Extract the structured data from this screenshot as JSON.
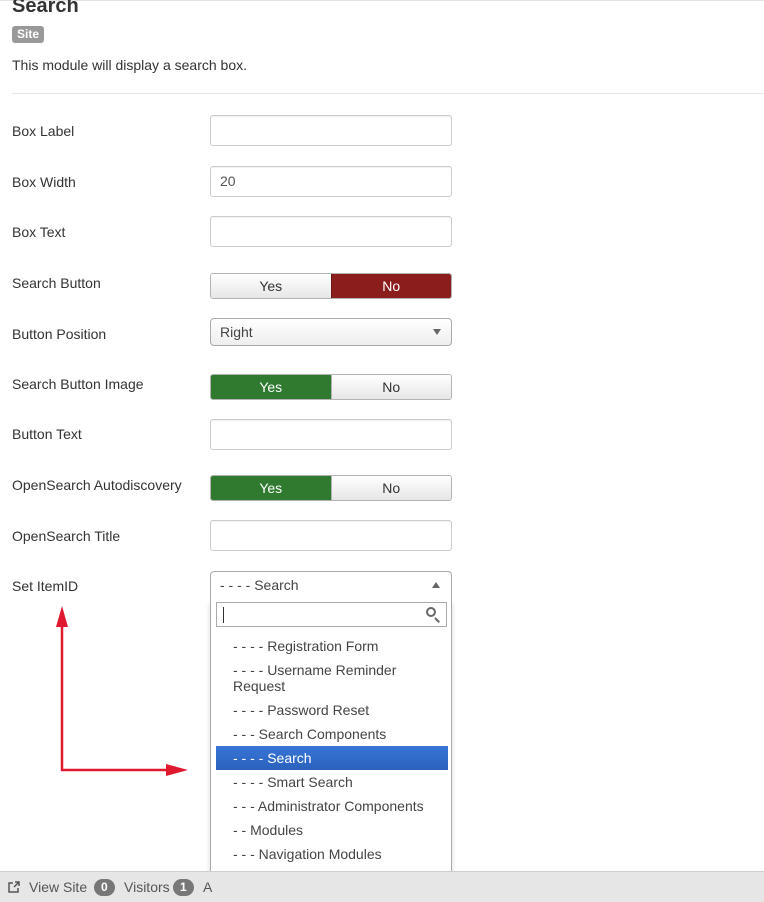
{
  "module": {
    "title": "Search",
    "client_badge": "Site",
    "description": "This module will display a search box."
  },
  "fields": {
    "box_label": {
      "label": "Box Label",
      "value": ""
    },
    "box_width": {
      "label": "Box Width",
      "value": "20"
    },
    "box_text": {
      "label": "Box Text",
      "value": ""
    },
    "search_button": {
      "label": "Search Button",
      "yes": "Yes",
      "no": "No",
      "selected": "No"
    },
    "button_position": {
      "label": "Button Position",
      "value": "Right"
    },
    "search_button_image": {
      "label": "Search Button Image",
      "yes": "Yes",
      "no": "No",
      "selected": "Yes"
    },
    "button_text": {
      "label": "Button Text",
      "value": ""
    },
    "opensearch_autodiscovery": {
      "label": "OpenSearch Autodiscovery",
      "yes": "Yes",
      "no": "No",
      "selected": "Yes"
    },
    "opensearch_title": {
      "label": "OpenSearch Title",
      "value": ""
    },
    "set_itemid": {
      "label": "Set ItemID",
      "value": "- - - - Search",
      "search_value": "",
      "options": [
        "- - - - Registration Form",
        "- - - - Username Reminder Request",
        "- - - - Password Reset",
        "- - - Search Components",
        "- - - - Search",
        "- - - - Smart Search",
        "- - - Administrator Components",
        "- - Modules",
        "- - - Navigation Modules"
      ],
      "highlighted_index": 4
    }
  },
  "footer": {
    "view_site": "View Site",
    "visitors_count": "0",
    "visitors_label": "Visitors",
    "admins_count": "1",
    "admins_label": "A"
  },
  "colors": {
    "toggle_no_active": "#8c1d1d",
    "toggle_yes_active": "#2f7a2f",
    "option_highlight": "#3875d7",
    "annotation_arrow": "#e0192f"
  },
  "icons": {
    "dropdown_search": "search-icon",
    "view_site": "external-link-icon"
  }
}
